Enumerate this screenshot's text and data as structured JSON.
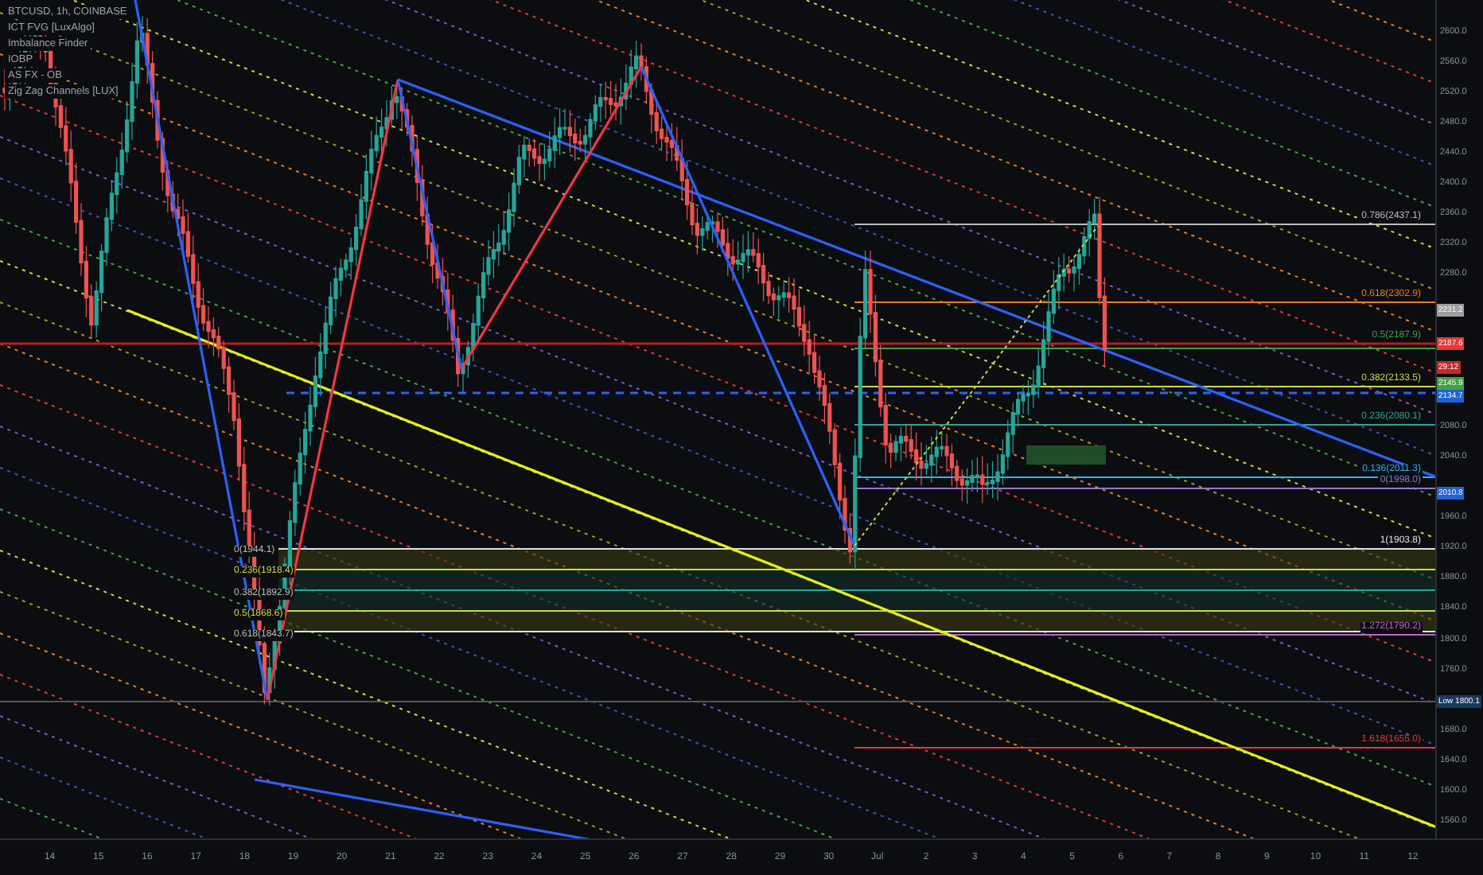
{
  "legend": [
    "BTCUSD, 1h, COINBASE",
    "ICT FVG [LuxAlgo]",
    "Imbalance Finder",
    "IOBP",
    "AS FX - OB",
    "Zig Zag Channels [LUX]"
  ],
  "y_axis": {
    "ticks": [
      "2600.0",
      "2560.0",
      "2520.0",
      "2480.0",
      "2440.0",
      "2400.0",
      "2360.0",
      "2320.0",
      "2280.0",
      "2080.0",
      "2040.0",
      "1960.0",
      "1920.0",
      "1880.0",
      "1840.0",
      "1800.0",
      "1760.0",
      "1680.0",
      "1640.0",
      "1600.0",
      "1560.0"
    ]
  },
  "x_axis": {
    "ticks": [
      "14",
      "15",
      "16",
      "17",
      "18",
      "19",
      "20",
      "21",
      "22",
      "23",
      "24",
      "25",
      "26",
      "27",
      "28",
      "29",
      "30",
      "Jul",
      "2",
      "3",
      "4",
      "5",
      "6",
      "7",
      "8",
      "9",
      "10",
      "11",
      "12"
    ]
  },
  "price_labels": [
    {
      "text": "2231.2",
      "color": "#9e9e9e"
    },
    {
      "text": "2187.6",
      "color": "#e53935"
    },
    {
      "text": "29:12",
      "color": "#c62828"
    },
    {
      "text": "2145.9",
      "color": "#43a047"
    },
    {
      "text": "2134.7",
      "color": "#1e63d6"
    },
    {
      "text": "2010.8",
      "color": "#1e63d6"
    },
    {
      "text": "Low 1800.1",
      "color": "#1a3a5c"
    }
  ],
  "fib_labels_right": [
    {
      "text": "0.786(2437.1)",
      "color": "#bdbdbd"
    },
    {
      "text": "0.618(2302.9)",
      "color": "#e67e22"
    },
    {
      "text": "0.5(2187.9)",
      "color": "#43a047"
    },
    {
      "text": "0.382(2133.5)",
      "color": "#cddc39"
    },
    {
      "text": "0.236(2080.1)",
      "color": "#26a69a"
    },
    {
      "text": "0.136(2011.3)",
      "color": "#29b6f6"
    },
    {
      "text": "0(1998.0)",
      "color": "#9575cd"
    },
    {
      "text": "1(1903.8)",
      "color": "#e0e0e0"
    },
    {
      "text": "1.272(1790.2)",
      "color": "#ba68c8"
    },
    {
      "text": "1.618(1655.0)",
      "color": "#e53935"
    }
  ],
  "fib_labels_left": [
    {
      "text": "0(1944.1)",
      "color": "#bdbdbd"
    },
    {
      "text": "0.236(1918.4)",
      "color": "#cddc39"
    },
    {
      "text": "0.382(1892.9)",
      "color": "#bdbdbd"
    },
    {
      "text": "0.5(1868.6)",
      "color": "#cddc39"
    },
    {
      "text": "0.618(1843.7)",
      "color": "#bdbdbd"
    }
  ]
}
